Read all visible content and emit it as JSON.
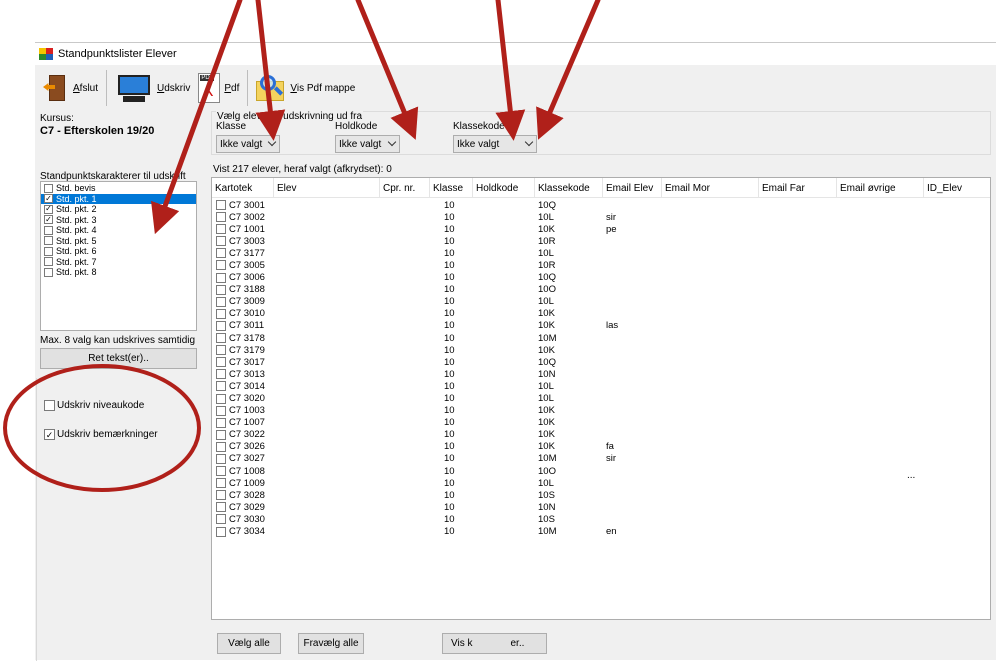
{
  "window": {
    "title": "Standpunktslister Elever"
  },
  "toolbar": {
    "exit_label": "Afslut",
    "print_label": "Udskriv",
    "pdf_label": "Pdf",
    "show_pdf_folder_label": "Vis Pdf mappe"
  },
  "course": {
    "label": "Kursus:",
    "value": "C7 - Efterskolen 19/20"
  },
  "selection": {
    "legend": "Vælg elever til udskrivning ud fra",
    "klasse_label": "Klasse",
    "klasse_value": "Ikke valgt",
    "holdkode_label": "Holdkode",
    "holdkode_value": "Ikke valgt",
    "klassekode_label": "Klassekode",
    "klassekode_value": "Ikke valgt"
  },
  "grades": {
    "label": "Standpunktskarakterer til udskrift",
    "items": [
      {
        "label": "Std. bevis",
        "checked": false,
        "selected": false
      },
      {
        "label": "Std. pkt. 1",
        "checked": true,
        "selected": true
      },
      {
        "label": "Std. pkt. 2",
        "checked": true,
        "selected": false
      },
      {
        "label": "Std. pkt. 3",
        "checked": true,
        "selected": false
      },
      {
        "label": "Std. pkt. 4",
        "checked": false,
        "selected": false
      },
      {
        "label": "Std. pkt. 5",
        "checked": false,
        "selected": false
      },
      {
        "label": "Std. pkt. 6",
        "checked": false,
        "selected": false
      },
      {
        "label": "Std. pkt. 7",
        "checked": false,
        "selected": false
      },
      {
        "label": "Std. pkt. 8",
        "checked": false,
        "selected": false
      }
    ],
    "max_note": "Max. 8 valg kan udskrives samtidig",
    "edit_text_button": "Ret tekst(er).."
  },
  "options": {
    "print_level_code": {
      "label": "Udskriv niveaukode",
      "checked": false
    },
    "print_remarks": {
      "label": "Udskriv bemærkninger",
      "checked": true
    }
  },
  "grid": {
    "caption": "Vist 217 elever, heraf valgt (afkrydset): 0",
    "columns": [
      "Kartotek",
      "Elev",
      "Cpr. nr.",
      "Klasse",
      "Holdkode",
      "Klassekode",
      "Email Elev",
      "Email Mor",
      "Email Far",
      "Email øvrige",
      "ID_Elev"
    ],
    "rows": [
      {
        "kartotek": "C7  3001",
        "klasse": "10",
        "klassekode": "10Q",
        "email_elev": ""
      },
      {
        "kartotek": "C7  3002",
        "klasse": "10",
        "klassekode": "10L",
        "email_elev": "sir"
      },
      {
        "kartotek": "C7  1001",
        "klasse": "10",
        "klassekode": "10K",
        "email_elev": "pe"
      },
      {
        "kartotek": "C7  3003",
        "klasse": "10",
        "klassekode": "10R",
        "email_elev": ""
      },
      {
        "kartotek": "C7  3177",
        "klasse": "10",
        "klassekode": "10L",
        "email_elev": ""
      },
      {
        "kartotek": "C7  3005",
        "klasse": "10",
        "klassekode": "10R",
        "email_elev": ""
      },
      {
        "kartotek": "C7  3006",
        "klasse": "10",
        "klassekode": "10Q",
        "email_elev": ""
      },
      {
        "kartotek": "C7  3188",
        "klasse": "10",
        "klassekode": "10O",
        "email_elev": ""
      },
      {
        "kartotek": "C7  3009",
        "klasse": "10",
        "klassekode": "10L",
        "email_elev": ""
      },
      {
        "kartotek": "C7  3010",
        "klasse": "10",
        "klassekode": "10K",
        "email_elev": ""
      },
      {
        "kartotek": "C7  3011",
        "klasse": "10",
        "klassekode": "10K",
        "email_elev": "las"
      },
      {
        "kartotek": "C7  3178",
        "klasse": "10",
        "klassekode": "10M",
        "email_elev": ""
      },
      {
        "kartotek": "C7  3179",
        "klasse": "10",
        "klassekode": "10K",
        "email_elev": ""
      },
      {
        "kartotek": "C7  3017",
        "klasse": "10",
        "klassekode": "10Q",
        "email_elev": ""
      },
      {
        "kartotek": "C7  3013",
        "klasse": "10",
        "klassekode": "10N",
        "email_elev": ""
      },
      {
        "kartotek": "C7  3014",
        "klasse": "10",
        "klassekode": "10L",
        "email_elev": ""
      },
      {
        "kartotek": "C7  3020",
        "klasse": "10",
        "klassekode": "10L",
        "email_elev": ""
      },
      {
        "kartotek": "C7  1003",
        "klasse": "10",
        "klassekode": "10K",
        "email_elev": ""
      },
      {
        "kartotek": "C7  1007",
        "klasse": "10",
        "klassekode": "10K",
        "email_elev": ""
      },
      {
        "kartotek": "C7  3022",
        "klasse": "10",
        "klassekode": "10K",
        "email_elev": ""
      },
      {
        "kartotek": "C7  3026",
        "klasse": "10",
        "klassekode": "10K",
        "email_elev": "fa"
      },
      {
        "kartotek": "C7  3027",
        "klasse": "10",
        "klassekode": "10M",
        "email_elev": "sir"
      },
      {
        "kartotek": "C7  1008",
        "klasse": "10",
        "klassekode": "10O",
        "email_elev": ""
      },
      {
        "kartotek": "C7  1009",
        "klasse": "10",
        "klassekode": "10L",
        "email_elev": ""
      },
      {
        "kartotek": "C7  3028",
        "klasse": "10",
        "klassekode": "10S",
        "email_elev": ""
      },
      {
        "kartotek": "C7  3029",
        "klasse": "10",
        "klassekode": "10N",
        "email_elev": ""
      },
      {
        "kartotek": "C7  3030",
        "klasse": "10",
        "klassekode": "10S",
        "email_elev": ""
      },
      {
        "kartotek": "C7  3034",
        "klasse": "10",
        "klassekode": "10M",
        "email_elev": "en"
      }
    ],
    "ellipsis_note": "..."
  },
  "bottom": {
    "select_all": "Vælg alle",
    "deselect_all": "Fravælg alle",
    "show_button": "Vis k",
    "show_button_tail": "er.."
  },
  "colors": {
    "selection": "#0078d7",
    "annotation": "#b0201a"
  }
}
